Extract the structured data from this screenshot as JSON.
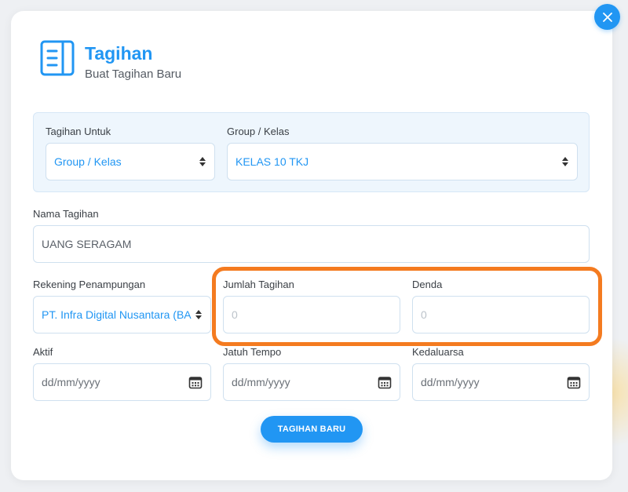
{
  "header": {
    "title": "Tagihan",
    "subtitle": "Buat Tagihan Baru",
    "icon": "document-icon"
  },
  "group_section": {
    "tagihan_untuk": {
      "label": "Tagihan Untuk",
      "value": "Group / Kelas"
    },
    "group_kelas": {
      "label": "Group / Kelas",
      "value": "KELAS 10 TKJ"
    }
  },
  "nama_tagihan": {
    "label": "Nama Tagihan",
    "value": "UANG SERAGAM"
  },
  "rekening": {
    "label": "Rekening Penampungan",
    "value": "PT. Infra Digital Nusantara (BA"
  },
  "jumlah_tagihan": {
    "label": "Jumlah Tagihan",
    "placeholder": "0"
  },
  "denda": {
    "label": "Denda",
    "placeholder": "0"
  },
  "aktif": {
    "label": "Aktif",
    "placeholder": "dd/mm/yyyy"
  },
  "jatuh_tempo": {
    "label": "Jatuh Tempo",
    "placeholder": "dd/mm/yyyy"
  },
  "kedaluarsa": {
    "label": "Kedaluarsa",
    "placeholder": "dd/mm/yyyy"
  },
  "submit_label": "TAGIHAN BARU",
  "colors": {
    "accent": "#2196f3",
    "highlight": "#f47b20",
    "panel_bg": "#eef6fd"
  }
}
